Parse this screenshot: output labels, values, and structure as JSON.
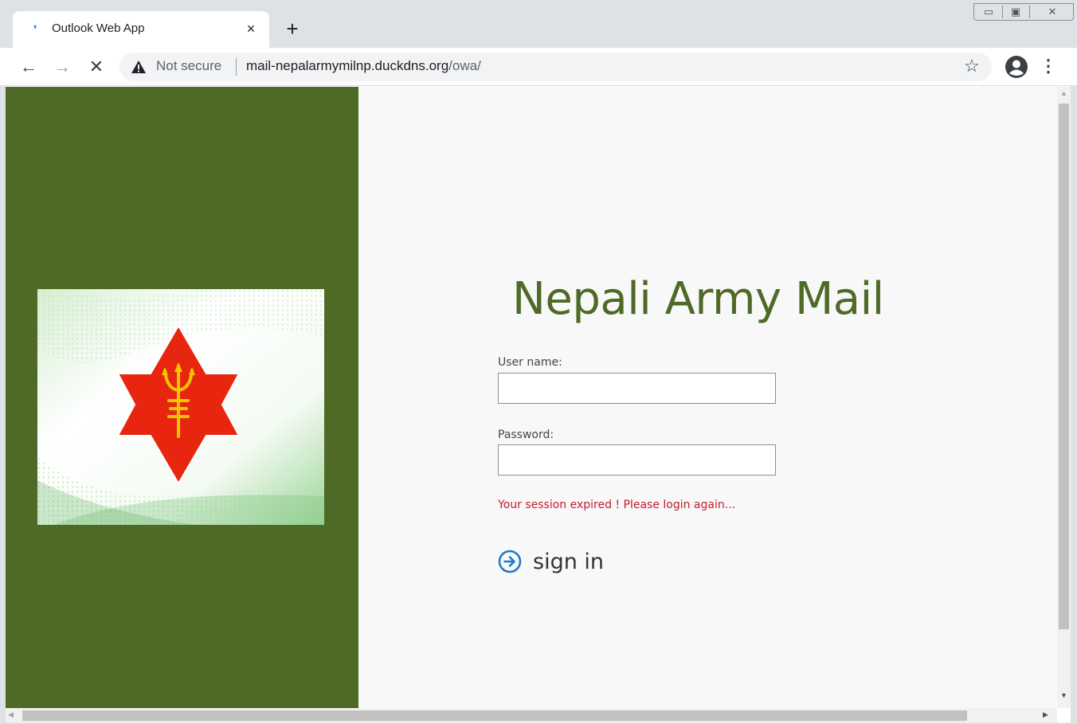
{
  "browser": {
    "tab_title": "Outlook Web App",
    "tab_close": "×",
    "new_tab": "+",
    "security_label": "Not secure",
    "url_host": "mail-nepalarmymilnp.duckdns.org",
    "url_path": "/owa/",
    "colors": {
      "tabstrip": "#dee1e6",
      "warning": "#202124"
    },
    "icons": [
      "back-arrow-icon",
      "forward-arrow-icon",
      "stop-icon",
      "warning-icon",
      "star-icon",
      "profile-icon",
      "menu-icon"
    ]
  },
  "page": {
    "heading": "Nepali Army Mail",
    "username_label": "User name:",
    "username_value": "",
    "password_label": "Password:",
    "password_value": "",
    "error_message": "Your session expired ! Please login again...",
    "signin_label": "sign in",
    "colors": {
      "accent": "#4e6a26",
      "error": "#c11d2d",
      "signin_icon": "#1e78c8",
      "star": "#e8260f",
      "trident": "#f5c400"
    }
  }
}
